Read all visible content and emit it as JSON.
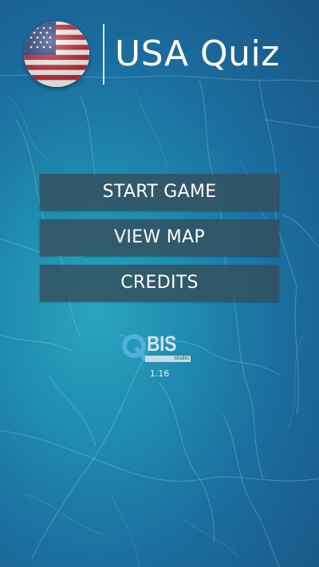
{
  "header": {
    "title": "USA Quiz",
    "flag_icon": "us-flag-icon"
  },
  "menu": {
    "items": [
      {
        "label": "START GAME"
      },
      {
        "label": "VIEW MAP"
      },
      {
        "label": "CREDITS"
      }
    ]
  },
  "footer": {
    "logo_text": "BIS",
    "logo_subtext": "studio",
    "version": "1.16"
  },
  "colors": {
    "background_light": "#2aa5bf",
    "background_dark": "#1a5686",
    "button_background": "#344e5c",
    "text": "#ffffff"
  }
}
